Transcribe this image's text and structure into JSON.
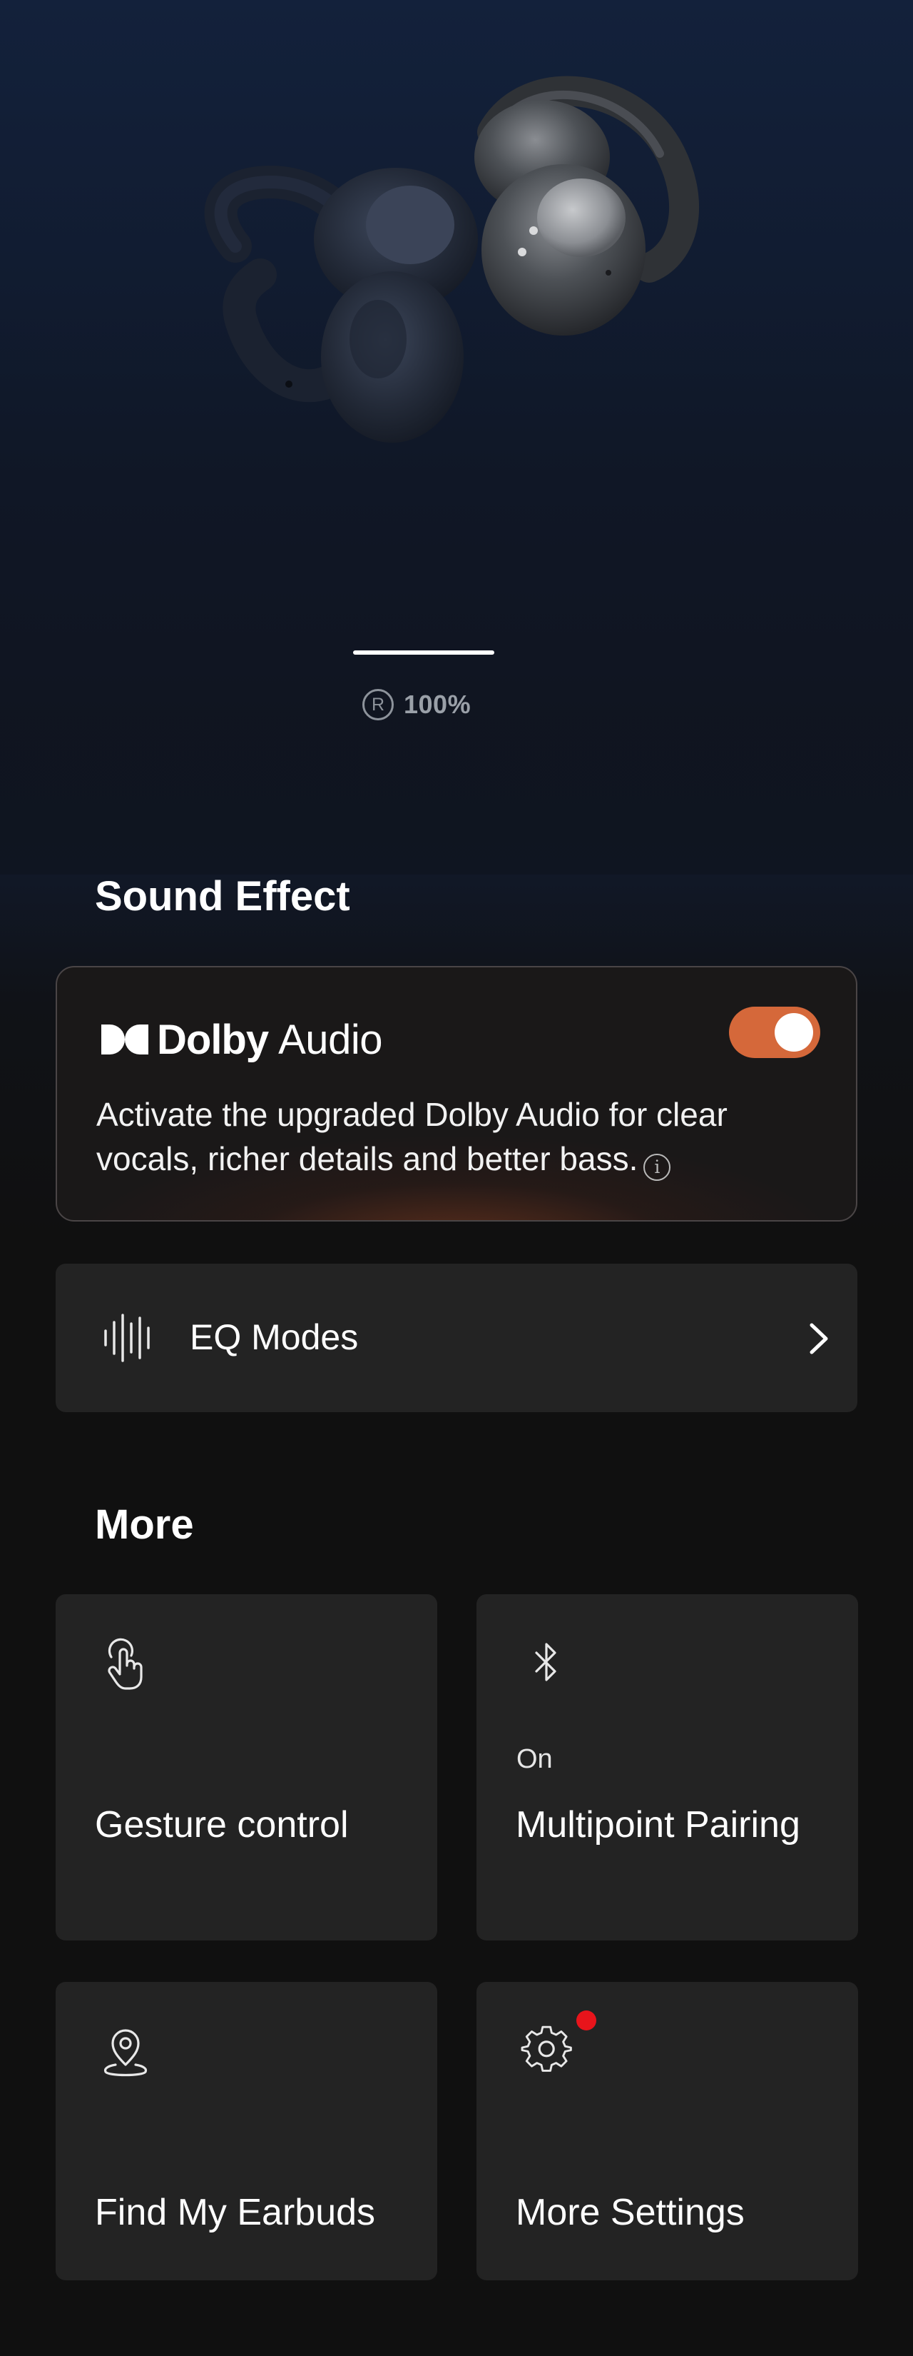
{
  "hero": {
    "battery_icon_letter": "R",
    "battery_percent": "100%"
  },
  "sound_effect": {
    "title": "Sound Effect",
    "dolby": {
      "brand_bold": "Dolby",
      "brand_light": "Audio",
      "toggle_on": true,
      "accent_color": "#d5683a",
      "description": "Activate the upgraded Dolby Audio for clear vocals, richer details and better bass."
    },
    "eq": {
      "label": "EQ Modes",
      "icon": "waveform-icon"
    }
  },
  "more": {
    "title": "More",
    "tiles": [
      {
        "label": "Gesture control",
        "icon": "touch-gesture-icon"
      },
      {
        "label": "Multipoint Pairing",
        "status": "On",
        "icon": "bluetooth-icon"
      },
      {
        "label": "Find My Earbuds",
        "icon": "location-pin-icon"
      },
      {
        "label": "More Settings",
        "icon": "gear-icon",
        "notification_dot": true,
        "dot_color": "#e8141b"
      }
    ]
  }
}
